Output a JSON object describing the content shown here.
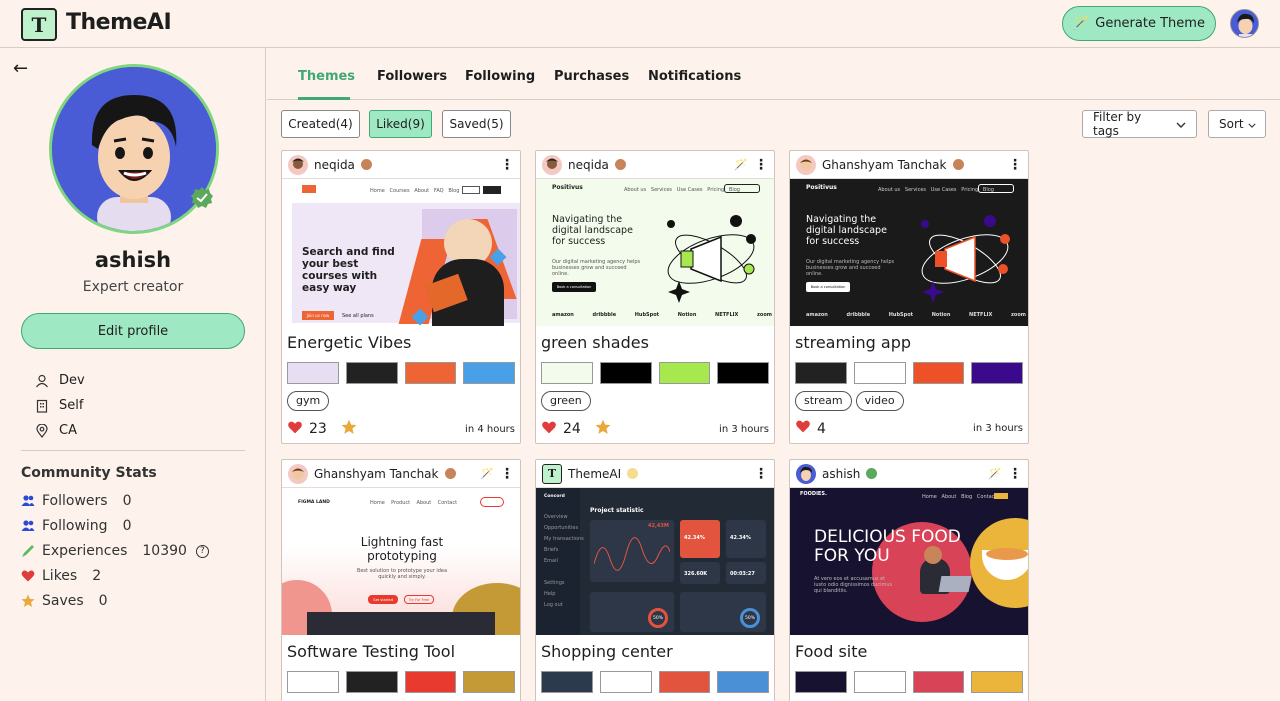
{
  "app": {
    "brand": "ThemeAI",
    "logo_letter": "T",
    "generate_label": "Generate Theme"
  },
  "profile": {
    "name": "ashish",
    "role": "Expert creator",
    "edit_label": "Edit profile",
    "info": [
      "Dev",
      "Self",
      "CA"
    ],
    "stats_title": "Community Stats",
    "stats": [
      {
        "label": "Followers",
        "value": "0",
        "icon": "followers-icon",
        "color": "#2b4bd6"
      },
      {
        "label": "Following",
        "value": "0",
        "icon": "following-icon",
        "color": "#2b4bd6"
      },
      {
        "label": "Experiences",
        "value": "10390",
        "icon": "brush-icon",
        "color": "#5dbb5d"
      },
      {
        "label": "Likes",
        "value": "2",
        "icon": "heart-icon",
        "color": "#e03c3c"
      },
      {
        "label": "Saves",
        "value": "0",
        "icon": "star-icon",
        "color": "#e8a93a"
      }
    ]
  },
  "tabs": [
    "Themes",
    "Followers",
    "Following",
    "Purchases",
    "Notifications"
  ],
  "active_tab": "Themes",
  "filters": {
    "created": "Created(4)",
    "liked": "Liked(9)",
    "saved": "Saved(5)",
    "tags": "Filter by tags",
    "sort": "Sort"
  },
  "cards": [
    {
      "author": "neqida",
      "title": "Energetic Vibes",
      "swatches": [
        "#e8def2",
        "#222222",
        "#ee6434",
        "#4aa0e6"
      ],
      "tags": [
        "gym"
      ],
      "likes": "23",
      "time": "in 4 hours",
      "preview": {
        "headline": "Search and find your best courses with easy way",
        "cta": "Join us now",
        "cta2": "See all plans"
      }
    },
    {
      "author": "neqida",
      "title": "green shades",
      "swatches": [
        "#f3fbec",
        "#000000",
        "#a6e84e",
        "#000000"
      ],
      "tags": [
        "green"
      ],
      "likes": "24",
      "time": "in 3 hours",
      "preview": {
        "brand": "Positivus",
        "headline": "Navigating the digital landscape for success",
        "cta": "Book a consultation",
        "logos": [
          "amazon",
          "dribbble",
          "HubSpot",
          "Notion",
          "NETFLIX",
          "zoom"
        ]
      }
    },
    {
      "author": "Ghanshyam Tanchak",
      "title": "streaming app",
      "swatches": [
        "#222222",
        "#ffffff",
        "#ee5028",
        "#3b0a8c"
      ],
      "tags": [
        "stream",
        "video"
      ],
      "likes": "4",
      "time": "in 3 hours",
      "preview": {
        "brand": "Positivus",
        "headline": "Navigating the digital landscape for success",
        "cta": "Book a consultation",
        "logos": [
          "amazon",
          "dribbble",
          "HubSpot",
          "Notion",
          "NETFLIX",
          "zoom"
        ]
      }
    },
    {
      "author": "Ghanshyam Tanchak",
      "title": "Software Testing Tool",
      "swatches": [
        "#ffffff",
        "#222222",
        "#e83a2e",
        "#c49a36"
      ],
      "tags": [],
      "likes": "",
      "time": "",
      "preview": {
        "brand": "FIGMA LAND",
        "headline": "Lightning fast prototyping",
        "cta": "Get started",
        "cta2": "Try For Free"
      }
    },
    {
      "author": "ThemeAI",
      "title": "Shopping center",
      "swatches": [
        "#2b3a4d",
        "#ffffff",
        "#e2543e",
        "#4a90d6"
      ],
      "tags": [],
      "likes": "",
      "time": "",
      "preview": {
        "brand": "Concord",
        "headline": "Project statistic",
        "stat1": "42,43M",
        "stat2": "42.34%",
        "stat3": "42.34%",
        "stat4": "326.60K",
        "stat5": "00:03:27",
        "p1": "50%",
        "p2": "50%"
      }
    },
    {
      "author": "ashish",
      "title": "Food site",
      "swatches": [
        "#161230",
        "#ffffff",
        "#d94357",
        "#ebb43a"
      ],
      "tags": [],
      "likes": "",
      "time": "",
      "preview": {
        "brand": "FOODIES.",
        "headline": "DELICIOUS FOOD FOR YOU"
      }
    }
  ]
}
